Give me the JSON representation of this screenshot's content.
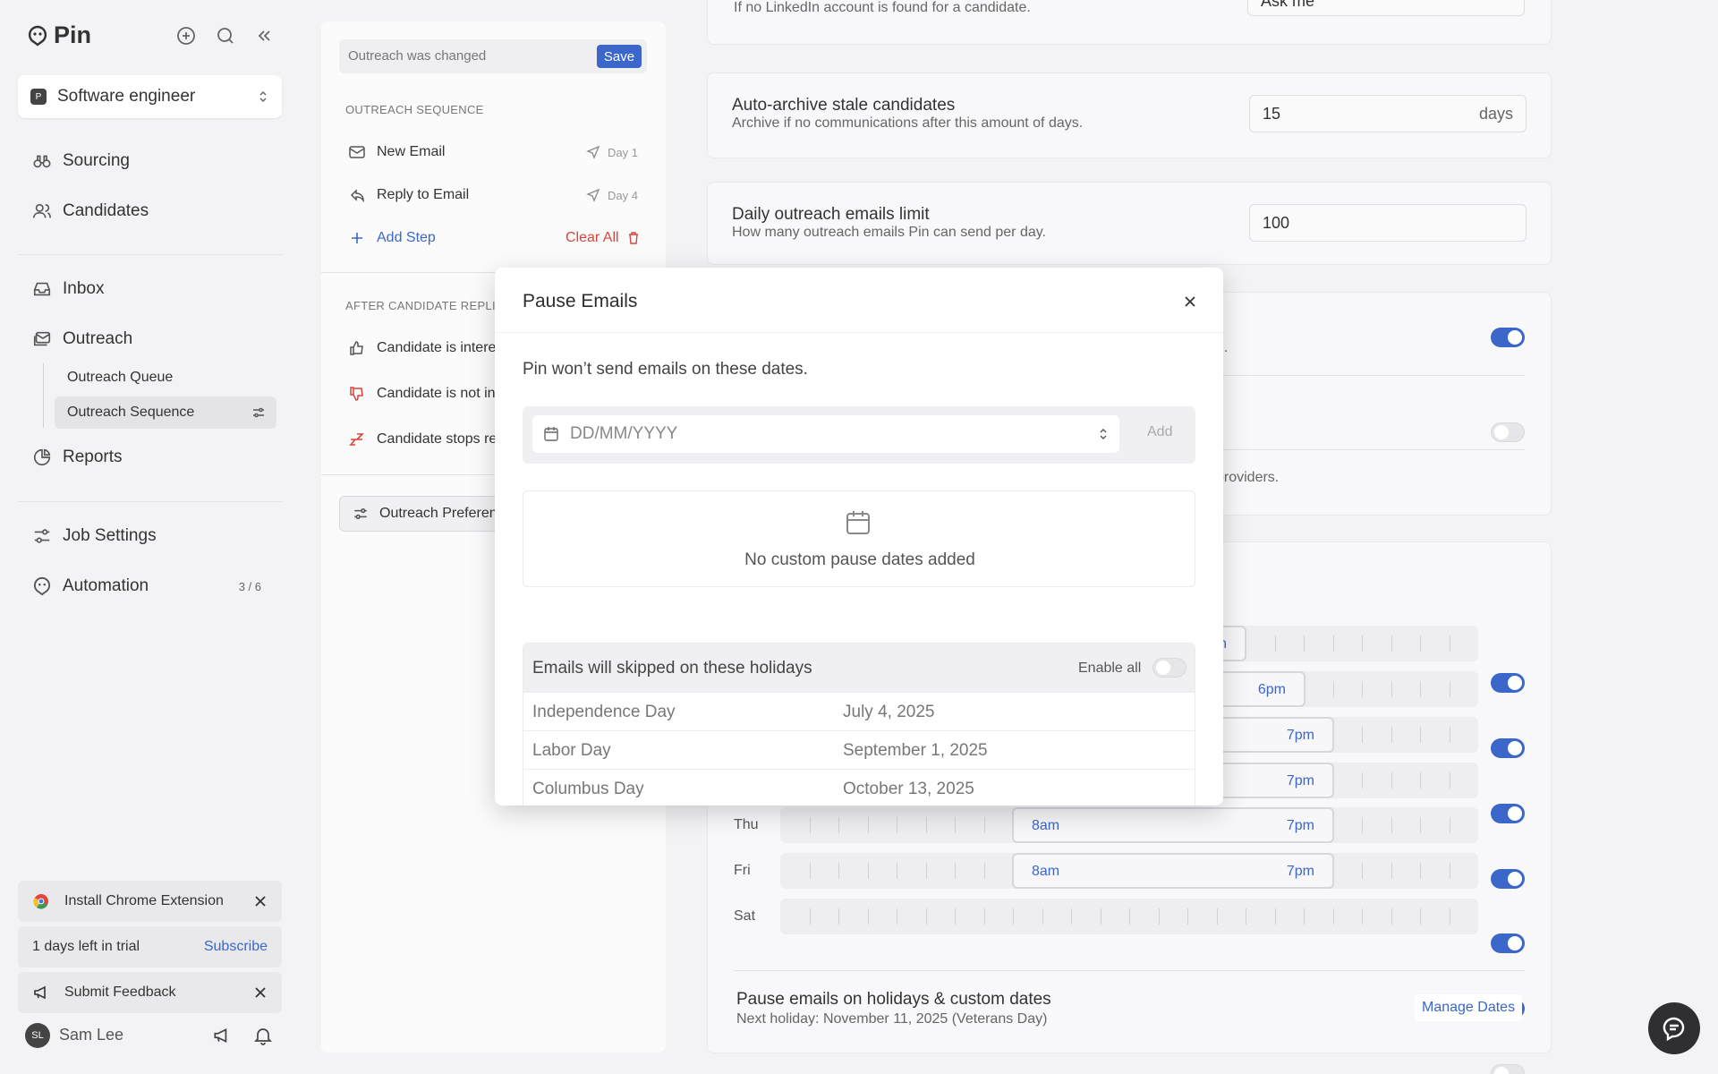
{
  "app": {
    "name": "Pin"
  },
  "sidebar": {
    "job": {
      "badge": "P",
      "label": "Software engineer"
    },
    "nav": {
      "sourcing": "Sourcing",
      "candidates": "Candidates",
      "inbox": "Inbox",
      "outreach": "Outreach",
      "outreach_queue": "Outreach Queue",
      "outreach_sequence": "Outreach Sequence",
      "reports": "Reports",
      "job_settings": "Job Settings",
      "automation": "Automation",
      "automation_count": "3 / 6"
    },
    "promos": {
      "chrome": "Install Chrome Extension",
      "trial": "1 days left in trial",
      "subscribe": "Subscribe",
      "feedback": "Submit Feedback"
    },
    "user": {
      "initials": "SL",
      "name": "Sam Lee"
    }
  },
  "sequence": {
    "changed_text": "Outreach was changed",
    "save_label": "Save",
    "section_label": "OUTREACH SEQUENCE",
    "steps": [
      {
        "label": "New Email",
        "day": "Day 1"
      },
      {
        "label": "Reply to Email",
        "day": "Day 4"
      }
    ],
    "add_step": "Add Step",
    "clear_all": "Clear All",
    "after_label": "AFTER CANDIDATE REPLIES",
    "replies": [
      "Candidate is interested",
      "Candidate is not interested",
      "Candidate stops responding"
    ],
    "preferences_button": "Outreach Preferences"
  },
  "settings": {
    "linkedin_desc": "If no LinkedIn account is found for a candidate.",
    "linkedin_value": "Ask me",
    "auto_archive_title": "Auto-archive stale candidates",
    "auto_archive_desc": "Archive if no communications after this amount of days.",
    "auto_archive_value": "15",
    "auto_archive_unit": "days",
    "daily_limit_title": "Daily outreach emails limit",
    "daily_limit_desc": "How many outreach emails Pin can send per day.",
    "daily_limit_value": "100",
    "partial_desc_1": "n.",
    "partial_desc_2": "providers.",
    "schedule": [
      {
        "day": "Thu",
        "start": "8am",
        "end": "7pm",
        "enabled": true
      },
      {
        "day": "Fri",
        "start": "8am",
        "end": "7pm",
        "enabled": true
      },
      {
        "day": "Sat",
        "start": "",
        "end": "",
        "enabled": false
      }
    ],
    "partial_times": [
      "n",
      "6pm",
      "7pm",
      "7pm"
    ],
    "pause_title": "Pause emails on holidays & custom dates",
    "pause_desc": "Next holiday: November 11, 2025 (Veterans Day)",
    "manage_dates": "Manage Dates"
  },
  "modal": {
    "title": "Pause Emails",
    "subtitle": "Pin won’t send emails on these dates.",
    "date_placeholder": "DD/MM/YYYY",
    "add_label": "Add",
    "empty_text": "No custom pause dates added",
    "holidays_title": "Emails will skipped on these holidays",
    "enable_all": "Enable all",
    "holidays": [
      {
        "name": "Independence Day",
        "date": "July 4, 2025"
      },
      {
        "name": "Labor Day",
        "date": "September 1, 2025"
      },
      {
        "name": "Columbus Day",
        "date": "October 13, 2025"
      }
    ]
  },
  "colors": {
    "accent": "#3a67c9",
    "text": "#2f2f33",
    "background": "#f3f3f5"
  }
}
